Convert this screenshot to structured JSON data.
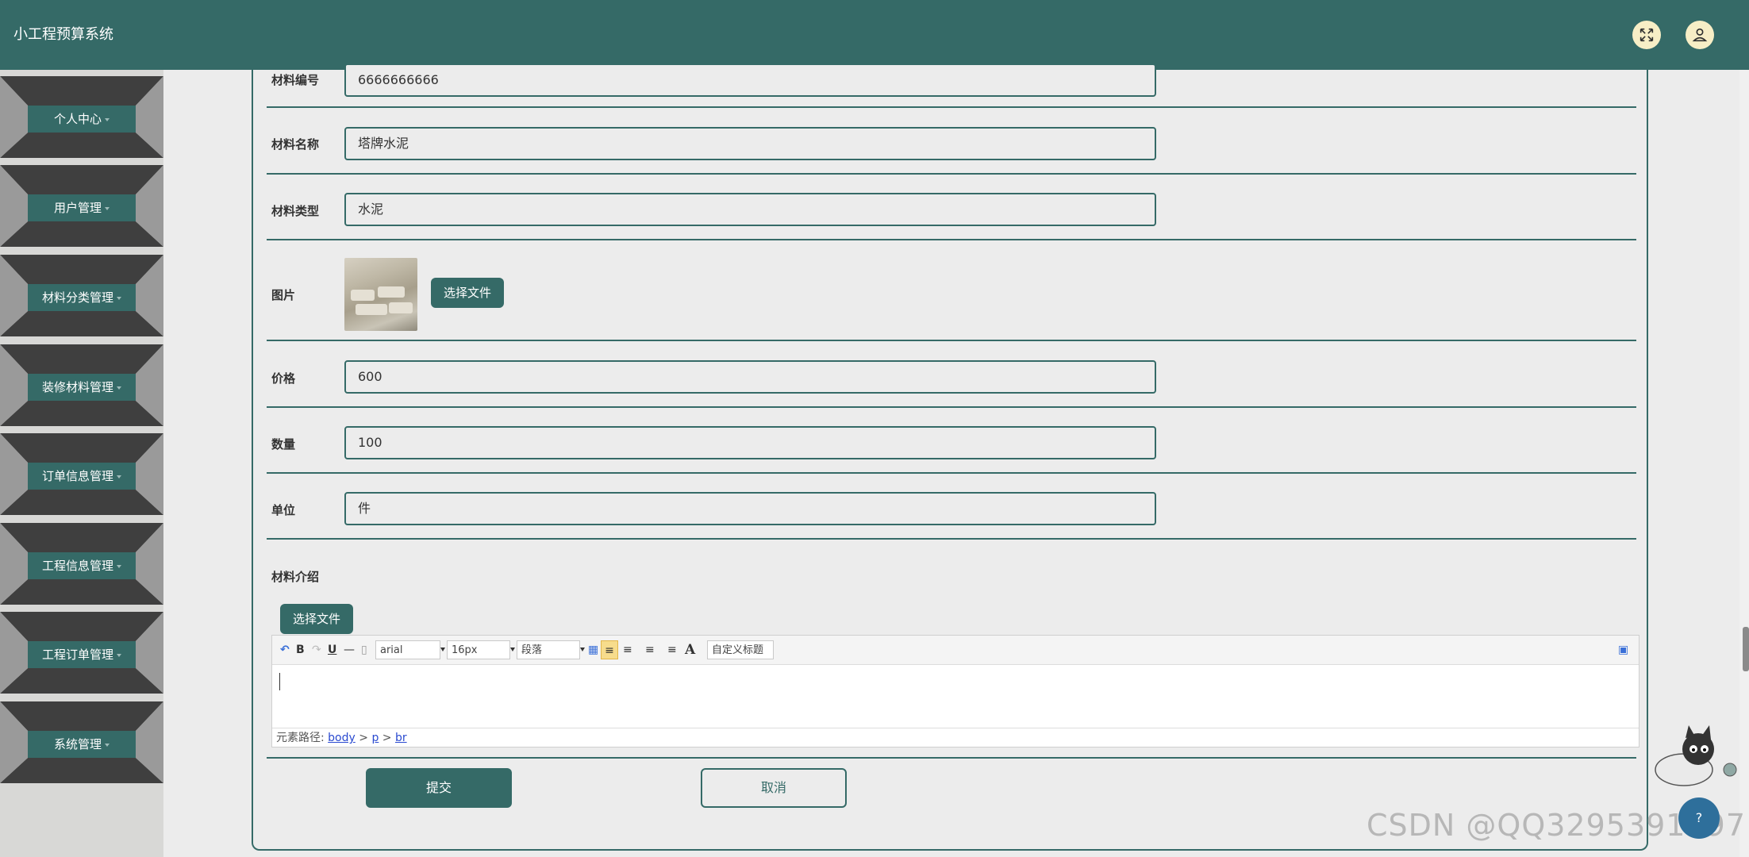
{
  "app": {
    "title": "小工程预算系统"
  },
  "header": {
    "fullscreen_icon": "fullscreen-icon",
    "user_icon": "user-icon"
  },
  "sidebar": {
    "items": [
      {
        "label": "个人中心"
      },
      {
        "label": "用户管理"
      },
      {
        "label": "材料分类管理"
      },
      {
        "label": "装修材料管理"
      },
      {
        "label": "订单信息管理"
      },
      {
        "label": "工程信息管理"
      },
      {
        "label": "工程订单管理"
      },
      {
        "label": "系统管理"
      }
    ]
  },
  "form": {
    "material_no": {
      "label": "材料编号",
      "value": "6666666666"
    },
    "material_name": {
      "label": "材料名称",
      "value": "塔牌水泥"
    },
    "material_type": {
      "label": "材料类型",
      "value": "水泥"
    },
    "image": {
      "label": "图片",
      "button": "选择文件"
    },
    "price": {
      "label": "价格",
      "value": "600"
    },
    "quantity": {
      "label": "数量",
      "value": "100"
    },
    "unit": {
      "label": "单位",
      "value": "件"
    },
    "intro": {
      "label": "材料介绍",
      "button": "选择文件"
    },
    "submit_label": "提交",
    "cancel_label": "取消"
  },
  "editor": {
    "font_family": "arial",
    "font_size": "16px",
    "paragraph": "段落",
    "custom_title": "自定义标题",
    "path_prefix": "元素路径:",
    "path": [
      "body",
      "p",
      "br"
    ]
  },
  "overlay": {
    "watermark": "CSDN @QQ3295391197",
    "help_text": "?"
  },
  "colors": {
    "primary": "#356a67",
    "header_icon_bg": "#f7eec6",
    "sidebar_dark": "#3f3f3f",
    "sidebar_light": "#9a9a9a"
  }
}
